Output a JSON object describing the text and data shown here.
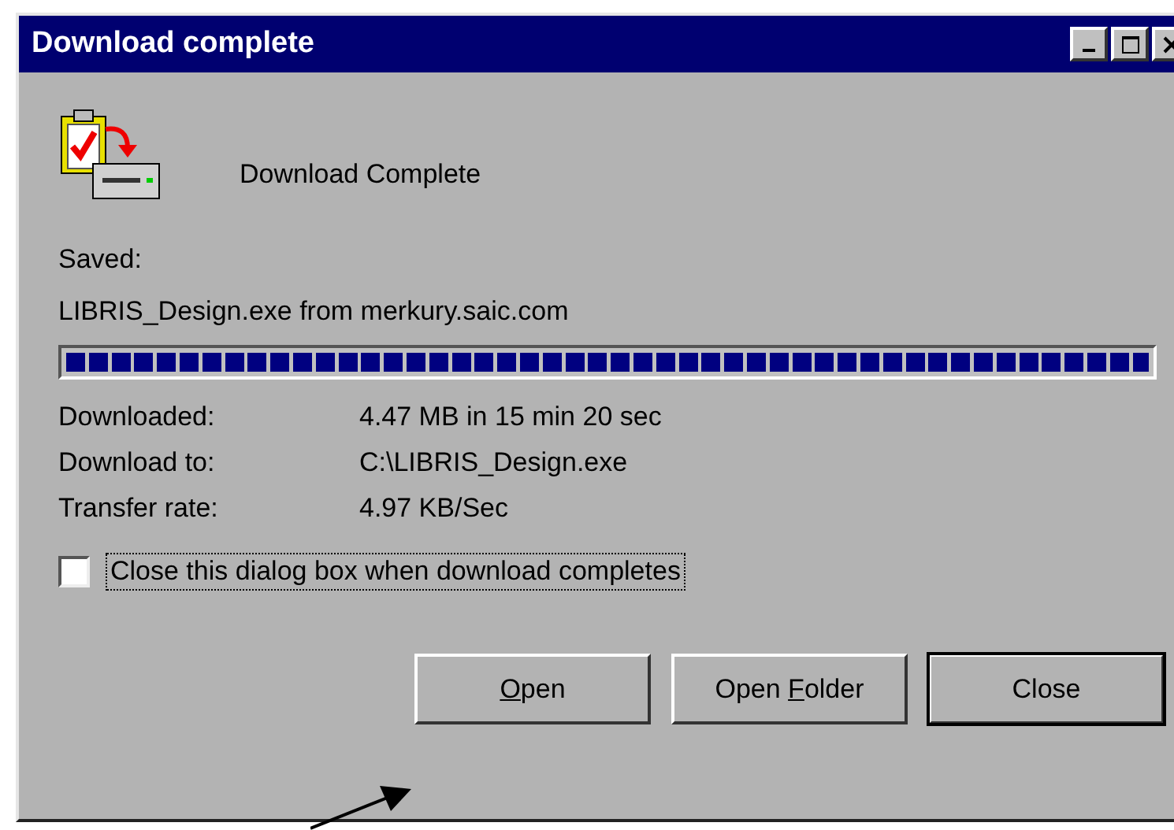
{
  "window": {
    "title": "Download complete"
  },
  "heading": "Download Complete",
  "saved": {
    "label": "Saved:",
    "file": "LIBRIS_Design.exe from merkury.saic.com"
  },
  "progress": {
    "level": 1
  },
  "details": [
    {
      "label": "Downloaded:",
      "value": "4.47 MB in 15 min 20 sec"
    },
    {
      "label": "Download to:",
      "value": "C:\\LIBRIS_Design.exe"
    },
    {
      "label": "Transfer rate:",
      "value": "4.97 KB/Sec"
    }
  ],
  "close_when_done": {
    "label": "Close this dialog box when download completes",
    "checked": false
  },
  "buttons": [
    {
      "label_parts": [
        {
          "text": "O",
          "underlined": true
        },
        {
          "text": "pen",
          "underlined": false
        }
      ],
      "default": false
    },
    {
      "label_parts": [
        {
          "text": "Open ",
          "underlined": false
        },
        {
          "text": "F",
          "underlined": true
        },
        {
          "text": "older",
          "underlined": false
        }
      ],
      "default": false
    },
    {
      "label_parts": [
        {
          "text": "Close",
          "underlined": false
        }
      ],
      "default": true
    }
  ]
}
